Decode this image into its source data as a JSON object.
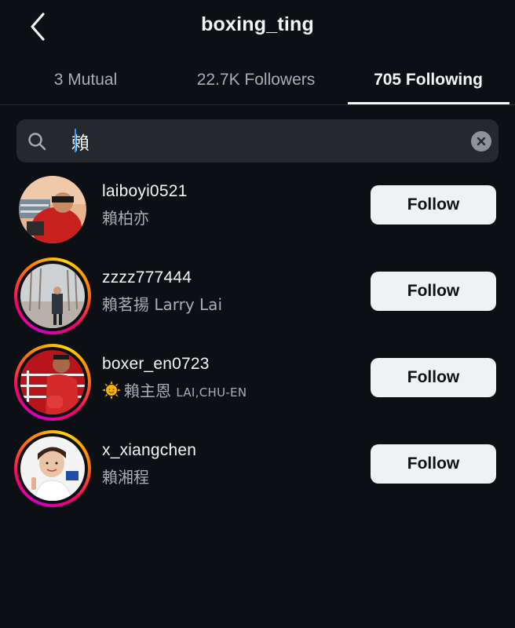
{
  "header": {
    "title": "boxing_ting"
  },
  "tabs": [
    {
      "label": "3 Mutual",
      "active": false
    },
    {
      "label": "22.7K Followers",
      "active": false
    },
    {
      "label": "705 Following",
      "active": true
    }
  ],
  "search": {
    "value": "賴"
  },
  "users": [
    {
      "username": "laiboyi0521",
      "name": "賴柏亦",
      "has_story_ring": false,
      "button": "Follow"
    },
    {
      "username": "zzzz777444",
      "name": "賴茗揚 Larry Lai",
      "has_story_ring": true,
      "button": "Follow"
    },
    {
      "username": "boxer_en0723",
      "name_emoji": "sun-emoji",
      "name": "賴主恩",
      "name_latin": "LAI,CHU-EN",
      "has_story_ring": true,
      "button": "Follow"
    },
    {
      "username": "x_xiangchen",
      "name": "賴湘程",
      "has_story_ring": true,
      "button": "Follow"
    }
  ],
  "colors": {
    "background": "#0c1014",
    "text_primary": "#f5f5f5",
    "text_secondary": "#a8adb3",
    "search_bg": "#25292e",
    "button_bg": "#f0f1f2",
    "caret": "#3897f0"
  }
}
